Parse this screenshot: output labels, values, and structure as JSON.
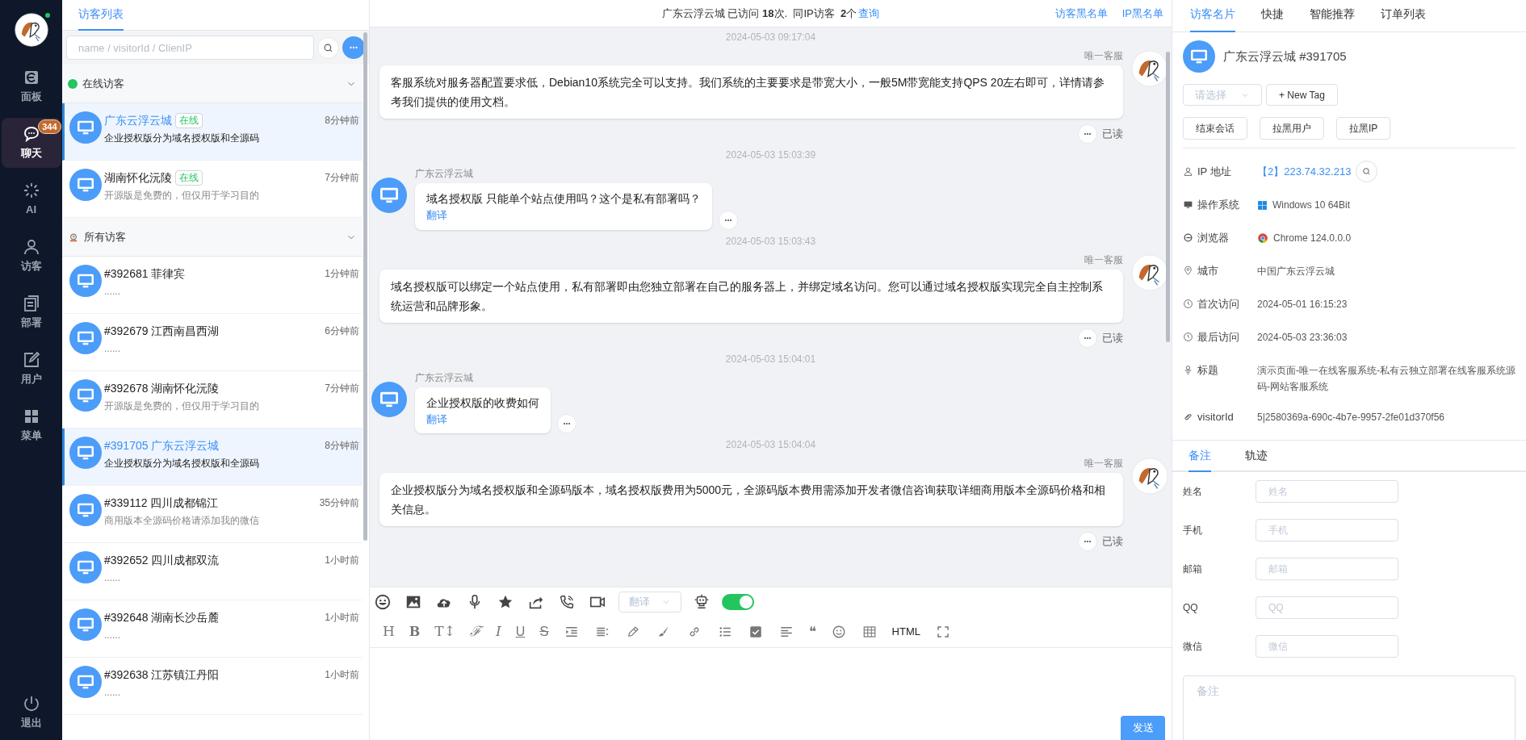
{
  "nav": {
    "online": true,
    "items": [
      {
        "kind": "dashboard",
        "label": "面板",
        "selected": false
      },
      {
        "kind": "chat",
        "label": "聊天",
        "selected": true,
        "badge": "344"
      },
      {
        "kind": "ai",
        "label": "AI",
        "selected": false
      },
      {
        "kind": "visitor",
        "label": "访客",
        "selected": false
      },
      {
        "kind": "deploy",
        "label": "部署",
        "selected": false
      },
      {
        "kind": "user",
        "label": "用户",
        "selected": false
      },
      {
        "kind": "menu",
        "label": "菜单",
        "selected": false
      }
    ],
    "logout": "退出"
  },
  "visitor_list": {
    "tab": "访客列表",
    "search": {
      "placeholder": "name / visitorId / ClienIP"
    },
    "groups": [
      {
        "kind": "online",
        "title": "在线访客",
        "expanded": true,
        "items": [
          {
            "name": "广东云浮云城",
            "tag": "在线",
            "time": "8分钟前",
            "preview": "企业授权版分为域名授权版和全源码",
            "selected": true
          },
          {
            "name": "湖南怀化沅陵",
            "tag": "在线",
            "time": "7分钟前",
            "preview": "开源版是免费的，但仅用于学习目的",
            "selected": false
          }
        ]
      },
      {
        "kind": "all",
        "title": "所有访客",
        "expanded": true,
        "items": [
          {
            "name": "#392681 菲律宾",
            "time": "1分钟前",
            "preview": "......",
            "selected": false
          },
          {
            "name": "#392679 江西南昌西湖",
            "time": "6分钟前",
            "preview": "......",
            "selected": false
          },
          {
            "name": "#392678 湖南怀化沅陵",
            "time": "7分钟前",
            "preview": "开源版是免费的，但仅用于学习目的",
            "selected": false
          },
          {
            "name": "#391705 广东云浮云城",
            "time": "8分钟前",
            "preview": "企业授权版分为域名授权版和全源码",
            "selected": true
          },
          {
            "name": "#339112 四川成都锦江",
            "time": "35分钟前",
            "preview": "商用版本全源码价格请添加我的微信",
            "selected": false
          },
          {
            "name": "#392652 四川成都双流",
            "time": "1小时前",
            "preview": "......",
            "selected": false
          },
          {
            "name": "#392648 湖南长沙岳麓",
            "time": "1小时前",
            "preview": "......",
            "selected": false
          },
          {
            "name": "#392638 江苏镇江丹阳",
            "time": "1小时前",
            "preview": "......",
            "selected": false
          }
        ]
      }
    ]
  },
  "chat": {
    "header": {
      "summary": "广东云浮云城 已访问 **18**次.  同IP访客  **2**个",
      "query_link": "查询",
      "links": [
        "访客黑名单",
        "IP黑名单"
      ]
    },
    "messages": [
      {
        "kind": "time",
        "text": "2024-05-03 09:17:04"
      },
      {
        "kind": "agent",
        "sender": "唯一客服",
        "text": "客服系统对服务器配置要求低，Debian10系统完全可以支持。我们系统的主要要求是带宽大小，一般5M带宽能支持QPS 20左右即可，详情请参考我们提供的使用文档。",
        "status": "已读"
      },
      {
        "kind": "time",
        "text": "2024-05-03 15:03:39"
      },
      {
        "kind": "visitor",
        "sender": "广东云浮云城",
        "text": "域名授权版 只能单个站点使用吗？这个是私有部署吗？",
        "action": "翻译"
      },
      {
        "kind": "time",
        "text": "2024-05-03 15:03:43"
      },
      {
        "kind": "agent",
        "sender": "唯一客服",
        "text": "域名授权版可以绑定一个站点使用，私有部署即由您独立部署在自己的服务器上，并绑定域名访问。您可以通过域名授权版实现完全自主控制系统运营和品牌形象。",
        "status": "已读"
      },
      {
        "kind": "time",
        "text": "2024-05-03 15:04:01"
      },
      {
        "kind": "visitor",
        "sender": "广东云浮云城",
        "text": "企业授权版的收费如何",
        "action": "翻译"
      },
      {
        "kind": "time",
        "text": "2024-05-03 15:04:04"
      },
      {
        "kind": "agent",
        "sender": "唯一客服",
        "text": "企业授权版分为域名授权版和全源码版本，域名授权版费用为5000元，全源码版本费用需添加开发者微信咨询获取详细商用版本全源码价格和相关信息。",
        "status": "已读"
      }
    ],
    "translate_select": {
      "placeholder": "翻译"
    },
    "auto_reply": {
      "on": true
    },
    "editor_tools": [
      {
        "kind": "heading",
        "text": "H"
      },
      {
        "kind": "bold",
        "text": "B"
      },
      {
        "kind": "font-size",
        "text": "T↕"
      },
      {
        "kind": "font",
        "text": "ℱ"
      },
      {
        "kind": "italic",
        "text": "I"
      },
      {
        "kind": "underline",
        "text": "U"
      },
      {
        "kind": "strike",
        "text": "S"
      },
      {
        "kind": "indent"
      },
      {
        "kind": "line-height"
      },
      {
        "kind": "pen"
      },
      {
        "kind": "brush"
      },
      {
        "kind": "link"
      },
      {
        "kind": "list"
      },
      {
        "kind": "checkbox"
      },
      {
        "kind": "align"
      },
      {
        "kind": "quote",
        "text": "❝"
      },
      {
        "kind": "smile"
      },
      {
        "kind": "table"
      },
      {
        "kind": "html",
        "text": "HTML"
      },
      {
        "kind": "fullscreen"
      }
    ],
    "send_button": "发送"
  },
  "profile": {
    "tabs": [
      {
        "label": "访客名片",
        "selected": true
      },
      {
        "label": "快捷",
        "selected": false
      },
      {
        "label": "智能推荐",
        "selected": false
      },
      {
        "label": "订单列表",
        "selected": false
      }
    ],
    "name": "广东云浮云城 #391705",
    "tag_select": {
      "placeholder": "请选择"
    },
    "new_tag": "+ New Tag",
    "actions": [
      "结束会话",
      "拉黑用户",
      "拉黑IP"
    ],
    "info": [
      {
        "kind": "ip",
        "label": "IP 地址",
        "prefix": "【2】",
        "value": "223.74.32.213"
      },
      {
        "kind": "os",
        "label": "操作系统",
        "value": "Windows 10 64Bit"
      },
      {
        "kind": "browser",
        "label": "浏览器",
        "value": "Chrome 124.0.0.0"
      },
      {
        "kind": "city",
        "label": "城市",
        "value": "中国广东云浮云城"
      },
      {
        "kind": "first",
        "label": "首次访问",
        "value": "2024-05-01 16:15:23"
      },
      {
        "kind": "last",
        "label": "最后访问",
        "value": "2024-05-03 23:36:03"
      },
      {
        "kind": "title",
        "label": "标题",
        "value": "演示页面-唯一在线客服系统-私有云独立部署在线客服系统源码-网站客服系统"
      },
      {
        "kind": "id",
        "label": "visitorId",
        "value": "5|2580369a-690c-4b7e-9957-2fe01d370f56"
      }
    ],
    "note_tabs": [
      {
        "label": "备注",
        "selected": true
      },
      {
        "label": "轨迹",
        "selected": false
      }
    ],
    "fields": [
      {
        "label": "姓名",
        "placeholder": "姓名"
      },
      {
        "label": "手机",
        "placeholder": "手机"
      },
      {
        "label": "邮箱",
        "placeholder": "邮箱"
      },
      {
        "label": "QQ",
        "placeholder": "QQ"
      },
      {
        "label": "微信",
        "placeholder": "微信"
      }
    ],
    "note": {
      "placeholder": "备注"
    }
  }
}
